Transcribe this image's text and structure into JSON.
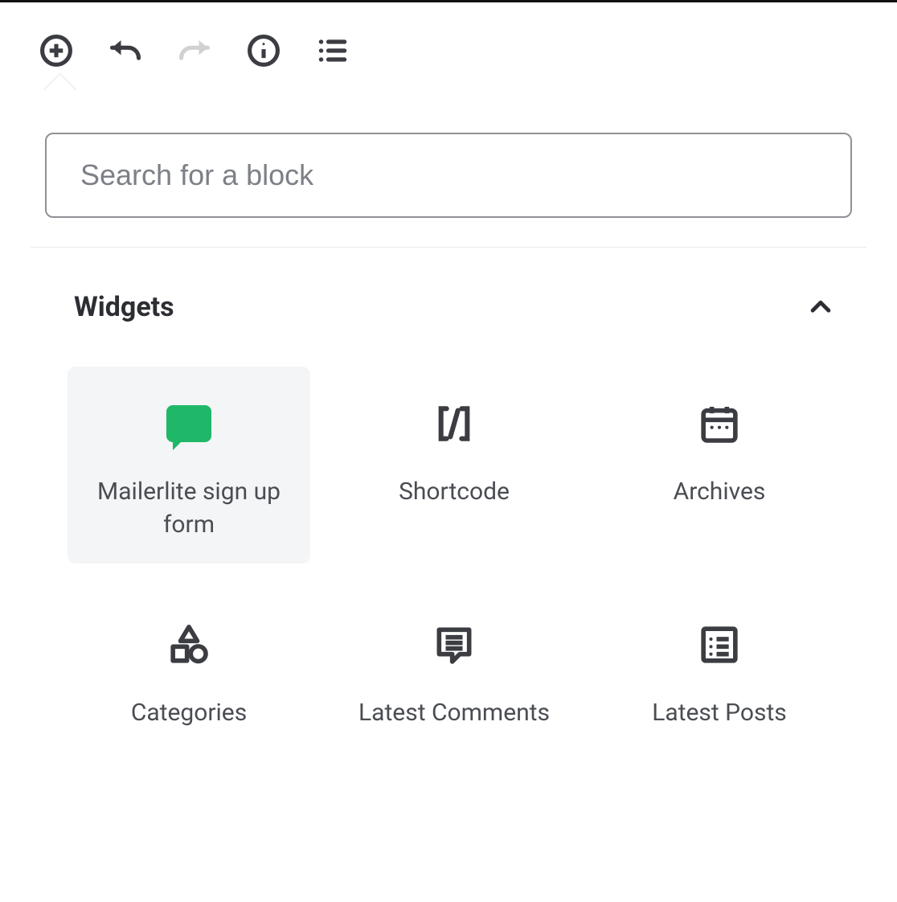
{
  "toolbar": {
    "add": "Add block",
    "undo": "Undo",
    "redo": "Redo",
    "info": "Content structure",
    "outline": "Block navigation"
  },
  "search": {
    "placeholder": "Search for a block"
  },
  "section": {
    "title": "Widgets"
  },
  "blocks": {
    "mailerlite": {
      "label": "Mailerlite sign up form"
    },
    "shortcode": {
      "label": "Shortcode"
    },
    "archives": {
      "label": "Archives"
    },
    "categories": {
      "label": "Categories"
    },
    "latest_comments": {
      "label": "Latest Comments"
    },
    "latest_posts": {
      "label": "Latest Posts"
    }
  }
}
